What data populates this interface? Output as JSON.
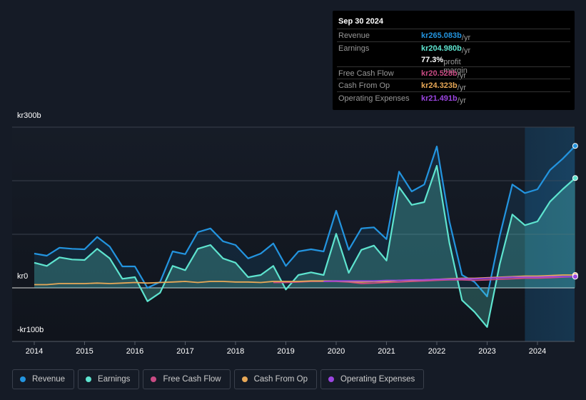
{
  "tooltip": {
    "date": "Sep 30 2024",
    "rows": [
      {
        "label": "Revenue",
        "value": "kr265.083b",
        "unit": " /yr",
        "color": "#2394df"
      },
      {
        "label": "Earnings",
        "value": "kr204.980b",
        "unit": " /yr",
        "color": "#5ee4cf"
      },
      {
        "label": "",
        "value": "77.3%",
        "unit": " profit margin",
        "color": "#ffffff"
      },
      {
        "label": "Free Cash Flow",
        "value": "kr20.528b",
        "unit": " /yr",
        "color": "#c94b84"
      },
      {
        "label": "Cash From Op",
        "value": "kr24.323b",
        "unit": " /yr",
        "color": "#e8a857"
      },
      {
        "label": "Operating Expenses",
        "value": "kr21.491b",
        "unit": " /yr",
        "color": "#9b45e0"
      }
    ]
  },
  "chart_data": {
    "type": "area",
    "ylim": [
      -100,
      300
    ],
    "y_ticks": [
      {
        "v": 300,
        "label": "kr300b"
      },
      {
        "v": 0,
        "label": "kr0"
      },
      {
        "v": -100,
        "label": "-kr100b"
      }
    ],
    "x_ticks": [
      "2014",
      "2015",
      "2016",
      "2017",
      "2018",
      "2019",
      "2020",
      "2021",
      "2022",
      "2023",
      "2024"
    ],
    "xlim": [
      2013.55,
      2024.75
    ],
    "highlight_from": 2023.75,
    "x": [
      2014,
      2014.25,
      2014.5,
      2014.75,
      2015,
      2015.25,
      2015.5,
      2015.75,
      2016,
      2016.25,
      2016.5,
      2016.75,
      2017,
      2017.25,
      2017.5,
      2017.75,
      2018,
      2018.25,
      2018.5,
      2018.75,
      2019,
      2019.25,
      2019.5,
      2019.75,
      2020,
      2020.25,
      2020.5,
      2020.75,
      2021,
      2021.25,
      2021.5,
      2021.75,
      2022,
      2022.25,
      2022.5,
      2022.75,
      2023,
      2023.25,
      2023.5,
      2023.75,
      2024,
      2024.25,
      2024.5,
      2024.75
    ],
    "series": [
      {
        "name": "Revenue",
        "color": "#2394df",
        "values": [
          64,
          60,
          75,
          73,
          72,
          95,
          77,
          40,
          40,
          0,
          11,
          68,
          63,
          104,
          111,
          87,
          80,
          55,
          64,
          83,
          41,
          68,
          72,
          68,
          144,
          71,
          111,
          113,
          91,
          217,
          180,
          193,
          264,
          124,
          24,
          11,
          -16,
          97,
          193,
          177,
          184,
          220,
          241,
          265
        ]
      },
      {
        "name": "Earnings",
        "color": "#5ee4cf",
        "values": [
          47,
          41,
          57,
          53,
          52,
          73,
          55,
          17,
          20,
          -25,
          -9,
          41,
          33,
          73,
          80,
          55,
          47,
          20,
          24,
          41,
          -3,
          24,
          29,
          24,
          101,
          28,
          71,
          79,
          51,
          188,
          155,
          160,
          228,
          84,
          -23,
          -45,
          -73,
          44,
          137,
          117,
          124,
          161,
          184,
          205
        ]
      },
      {
        "name": "Free Cash Flow",
        "color": "#c94b84",
        "values": [
          null,
          null,
          null,
          null,
          null,
          null,
          null,
          null,
          null,
          null,
          null,
          null,
          null,
          null,
          null,
          null,
          null,
          null,
          null,
          10,
          10,
          11,
          12,
          12,
          12,
          11,
          8,
          9,
          10,
          11,
          12,
          13,
          14,
          15,
          15,
          14,
          15,
          16,
          17,
          18,
          18,
          19,
          20,
          21
        ]
      },
      {
        "name": "Cash From Op",
        "color": "#e8a857",
        "values": [
          6,
          6,
          8,
          8,
          8,
          9,
          8,
          9,
          10,
          9,
          10,
          11,
          12,
          10,
          12,
          12,
          11,
          11,
          10,
          12,
          12,
          12,
          13,
          13,
          13,
          12,
          11,
          12,
          12,
          14,
          14,
          15,
          16,
          17,
          18,
          18,
          19,
          20,
          21,
          22,
          22,
          23,
          24,
          24
        ]
      },
      {
        "name": "Operating Expenses",
        "color": "#9b45e0",
        "values": [
          null,
          null,
          null,
          null,
          null,
          null,
          null,
          null,
          null,
          null,
          null,
          null,
          null,
          null,
          null,
          null,
          null,
          null,
          null,
          null,
          null,
          null,
          null,
          12,
          13,
          13,
          13,
          13,
          14,
          14,
          15,
          15,
          16,
          16,
          17,
          17,
          18,
          19,
          20,
          20,
          20,
          21,
          21,
          21
        ]
      }
    ]
  },
  "legend": [
    {
      "label": "Revenue",
      "color": "#2394df"
    },
    {
      "label": "Earnings",
      "color": "#5ee4cf"
    },
    {
      "label": "Free Cash Flow",
      "color": "#c94b84"
    },
    {
      "label": "Cash From Op",
      "color": "#e8a857"
    },
    {
      "label": "Operating Expenses",
      "color": "#9b45e0"
    }
  ]
}
